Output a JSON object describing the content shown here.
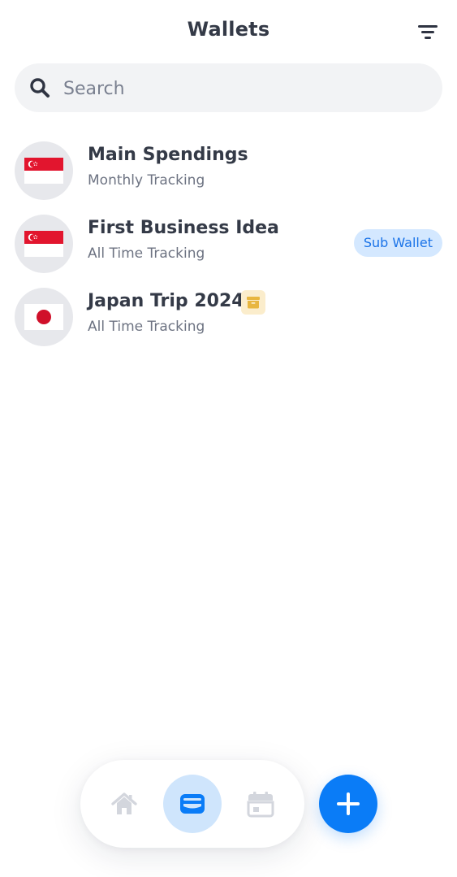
{
  "header": {
    "title": "Wallets",
    "filter_icon": "filter-icon"
  },
  "search": {
    "placeholder": "Search",
    "value": "",
    "icon": "search-icon"
  },
  "wallets": [
    {
      "name": "Main Spendings",
      "subtitle": "Monthly Tracking",
      "flag": "singapore-flag-icon"
    },
    {
      "name": "First Business Idea",
      "subtitle": "All Time Tracking",
      "flag": "singapore-flag-icon",
      "badge": "Sub Wallet"
    },
    {
      "name": "Japan Trip 2024",
      "subtitle": "All Time Tracking",
      "flag": "japan-flag-icon",
      "status_icon": "archive-icon"
    }
  ],
  "bottom_nav": {
    "items": [
      {
        "icon": "home-icon",
        "active": false
      },
      {
        "icon": "wallet-icon",
        "active": true
      },
      {
        "icon": "calendar-icon",
        "active": false
      }
    ],
    "fab_icon": "plus-icon"
  },
  "colors": {
    "accent": "#0a7cf7",
    "active_nav_bg": "#cfe5fc",
    "badge_bg": "#d4e8ff",
    "badge_text": "#1a73e8",
    "archive_bg": "#fbedcc",
    "archive_icon": "#e8b640",
    "flag_red": "#e2152e"
  }
}
